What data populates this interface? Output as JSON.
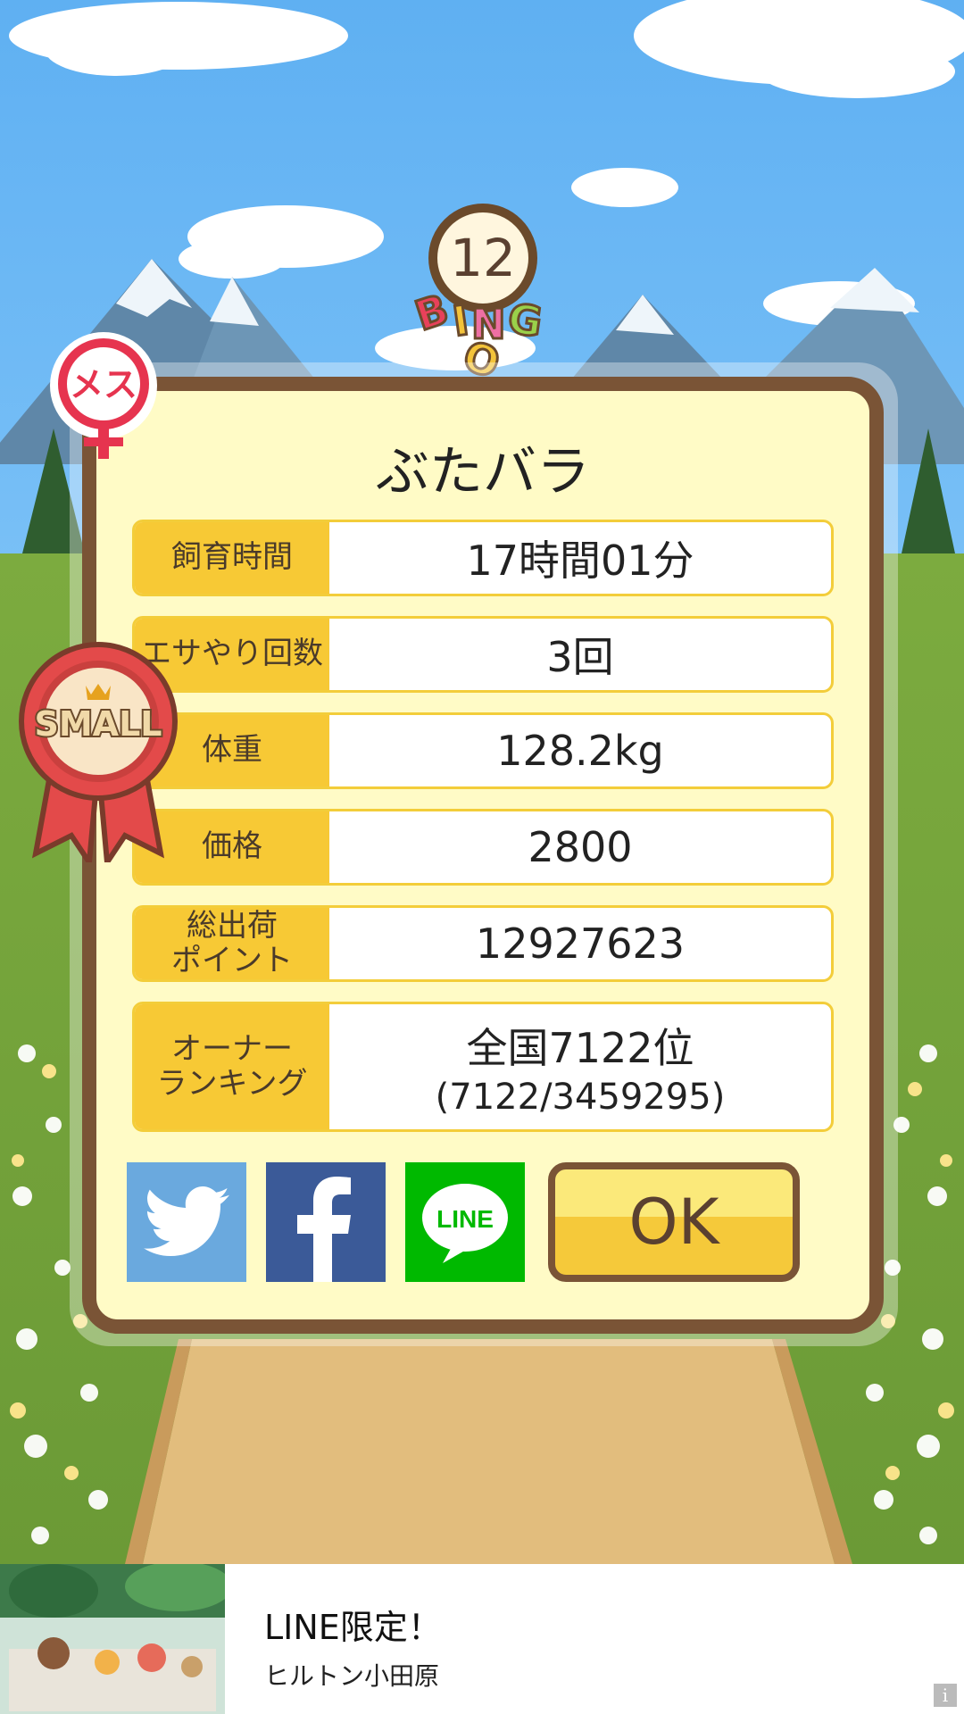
{
  "bingo": {
    "number": "12",
    "letters": [
      "B",
      "I",
      "N",
      "G",
      "O"
    ],
    "letter_colors": [
      "#e8415a",
      "#f3c33a",
      "#ee6fa3",
      "#9ad04a",
      "#f3c33a"
    ]
  },
  "gender_badge": {
    "text": "メス"
  },
  "ribbon": {
    "text": "SMALL"
  },
  "pig": {
    "name": "ぶたバラ"
  },
  "stats": [
    {
      "label": "飼育時間",
      "value": "17時間01分"
    },
    {
      "label": "エサやり回数",
      "value": "3回"
    },
    {
      "label": "体重",
      "value": "128.2kg"
    },
    {
      "label": "価格",
      "value": "2800"
    },
    {
      "label": "総出荷\nポイント",
      "value": "12927623"
    },
    {
      "label": "オーナー\nランキング",
      "value": "全国7122位",
      "sub": "(7122/3459295)"
    }
  ],
  "buttons": {
    "ok_label": "OK",
    "line_label": "LINE"
  },
  "ad": {
    "title": "LINE限定！",
    "subtitle": "ヒルトン小田原",
    "info": "i"
  },
  "colors": {
    "panel_bg": "#fffbc6",
    "panel_border": "#7a5436",
    "label_bg": "#f7c935",
    "twitter": "#6aa9de",
    "facebook": "#3b5a98",
    "line": "#00b900"
  }
}
